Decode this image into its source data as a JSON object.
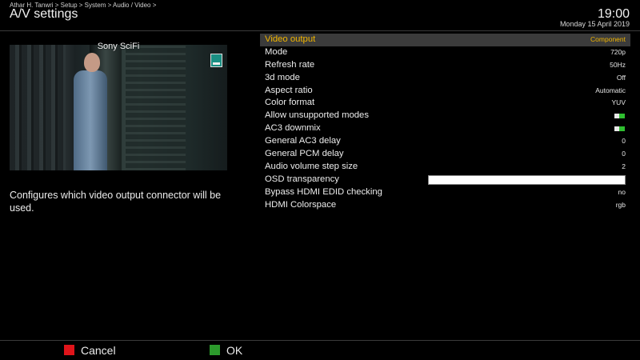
{
  "header": {
    "breadcrumb": "Athar H. Tanwri > Setup > System > Audio / Video >",
    "title": "A/V settings",
    "time": "19:00",
    "date": "Monday 15 April 2019"
  },
  "preview": {
    "channel_name": "Sony SciFi"
  },
  "description": "Configures which video output connector will be used.",
  "settings": [
    {
      "label": "Video output",
      "value": "Component",
      "selected": true
    },
    {
      "label": "Mode",
      "value": "720p"
    },
    {
      "label": "Refresh rate",
      "value": "50Hz"
    },
    {
      "label": "3d mode",
      "value": "Off"
    },
    {
      "label": "Aspect ratio",
      "value": "Automatic"
    },
    {
      "label": "Color format",
      "value": "YUV"
    },
    {
      "label": "Allow unsupported modes",
      "toggle": true
    },
    {
      "label": "AC3 downmix",
      "toggle": true
    },
    {
      "label": "General AC3 delay",
      "value": "0"
    },
    {
      "label": "General PCM delay",
      "value": "0"
    },
    {
      "label": "Audio volume step size",
      "value": "2"
    },
    {
      "label": "OSD transparency",
      "slider_level": 1.0
    },
    {
      "label": "Bypass HDMI EDID checking",
      "value": "no"
    },
    {
      "label": "HDMI Colorspace",
      "value": "rgb"
    }
  ],
  "footer": {
    "cancel_label": "Cancel",
    "ok_label": "OK",
    "cancel_color": "#e0141a",
    "ok_color": "#2c9a2c"
  },
  "colors": {
    "selected_text": "#f0b400",
    "toggle_on": "#2fbf30"
  }
}
